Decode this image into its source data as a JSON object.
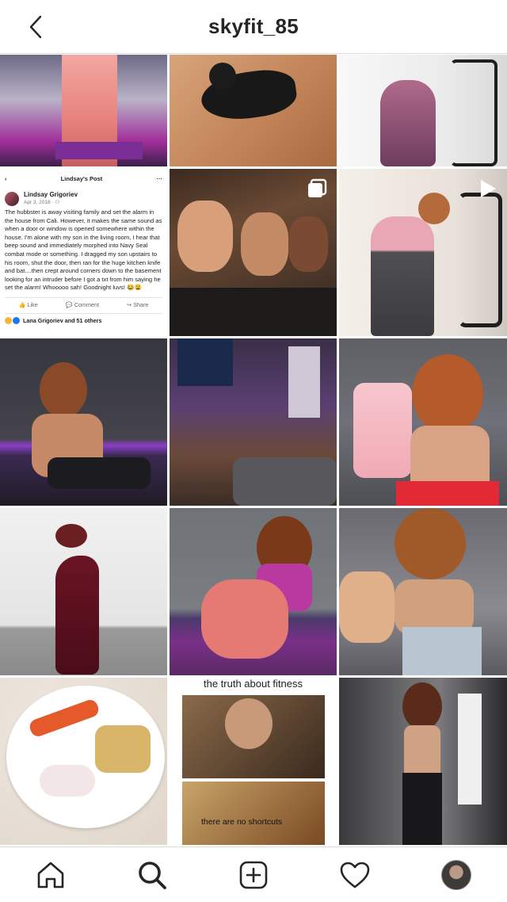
{
  "header": {
    "title": "skyfit_85",
    "back_icon": "chevron-left-icon"
  },
  "post_tile": {
    "page_title": "Lindsay's Post",
    "more": "···",
    "author": "Lindsay Grigoriev",
    "date": "Apr 3, 2018 · ⚇",
    "text": "The hubbster is away visiting family and set the alarm in the house from Cali. However, it makes the same sound as when a door or window is opened somewhere within the house. I'm alone with my son in the living room, I hear that beep sound and immediately morphed into Navy Seal combat mode or something. I dragged my son upstairs to his room, shut the door, then ran for the huge kitchen knife and bat....then crept around corners down to the basement looking for an intruder before I got a txt from him saying he set the alarm! Whooooo sah! Goodnight luvs! 😂😩",
    "like": "Like",
    "comment": "Comment",
    "share": "Share",
    "reactions": "Lana Grigoriev and 51 others"
  },
  "meme_tile": {
    "top_caption": "the truth about fitness",
    "bottom_caption": "there are no shortcuts"
  },
  "grid_tiles": [
    {
      "name": "photo-pink-leggings",
      "colors": [
        "#f0a6a0",
        "#7a2f8a"
      ]
    },
    {
      "name": "photo-black-cat",
      "colors": [
        "#c9926a",
        "#1c1c1c"
      ]
    },
    {
      "name": "photo-elliptical-workout",
      "colors": [
        "#f2f2f2",
        "#7c4a66"
      ]
    },
    {
      "name": "photo-embedded-post",
      "colors": [
        "#ffffff"
      ]
    },
    {
      "name": "photo-group-friends",
      "colors": [
        "#5c3b2a",
        "#d6a37c"
      ],
      "badge": "carousel-icon"
    },
    {
      "name": "photo-elliptical-video",
      "colors": [
        "#f1ede8",
        "#555555"
      ],
      "badge": "video-play-icon"
    },
    {
      "name": "photo-yoga-purple-light",
      "colors": [
        "#3b3b47",
        "#8b3fb8"
      ]
    },
    {
      "name": "photo-living-room",
      "colors": [
        "#3b2f52",
        "#8a4fb8"
      ]
    },
    {
      "name": "photo-protein-shake",
      "colors": [
        "#6a6a70",
        "#f3c1c7"
      ]
    },
    {
      "name": "photo-side-profile",
      "colors": [
        "#e7e7e7",
        "#5a1420"
      ]
    },
    {
      "name": "photo-sitting-pink",
      "colors": [
        "#7a7f84",
        "#e07a78"
      ]
    },
    {
      "name": "photo-peace-sign",
      "colors": [
        "#7e7e80",
        "#d1a07e"
      ]
    },
    {
      "name": "photo-sushi-plate",
      "colors": [
        "#e8dfd7",
        "#e55a2b"
      ]
    },
    {
      "name": "photo-meme",
      "colors": [
        "#ffffff",
        "#5b3a22"
      ]
    },
    {
      "name": "photo-mirror-selfie",
      "colors": [
        "#5e5e60",
        "#1f1f22"
      ]
    }
  ],
  "bottom_nav": [
    {
      "name": "home-icon"
    },
    {
      "name": "search-icon"
    },
    {
      "name": "new-post-icon"
    },
    {
      "name": "activity-heart-icon"
    },
    {
      "name": "profile-avatar"
    }
  ]
}
